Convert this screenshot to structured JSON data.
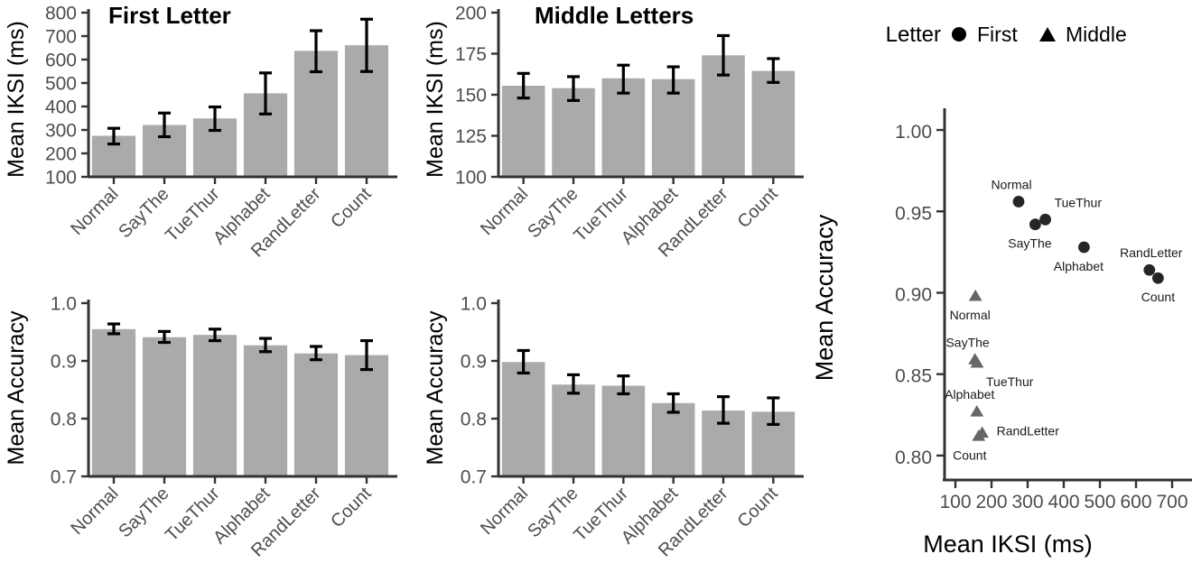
{
  "figure": {
    "conditions": [
      "Normal",
      "SayThe",
      "TueThur",
      "Alphabet",
      "RandLetter",
      "Count"
    ],
    "panels": {
      "first_iksi_title": "First Letter",
      "middle_iksi_title": "Middle Letters",
      "y_title_iksi": "Mean IKSI (ms)",
      "y_title_acc": "Mean Accuracy",
      "x_title_scatter": "Mean IKSI (ms)",
      "y_title_scatter": "Mean Accuracy"
    },
    "legend": {
      "title": "Letter",
      "items": [
        {
          "label": "First",
          "marker": "circle-marker",
          "color": "#262626"
        },
        {
          "label": "Middle",
          "marker": "triangle-marker",
          "color": "#666666"
        }
      ]
    },
    "colors": {
      "bar_fill": "#aaaaaa",
      "error_bar": "#000000",
      "tick_label": "#4d4d4d",
      "axis": "#333333",
      "first_point": "#262626",
      "middle_point": "#666666"
    }
  },
  "chart_data": [
    {
      "type": "bar",
      "id": "first-letter-iksi",
      "title": "First Letter",
      "xlabel": "",
      "ylabel": "Mean IKSI (ms)",
      "categories": [
        "Normal",
        "SayThe",
        "TueThur",
        "Alphabet",
        "RandLetter",
        "Count"
      ],
      "values": [
        275,
        321,
        349,
        456,
        637,
        661
      ],
      "err_low": [
        240,
        271,
        298,
        368,
        548,
        549
      ],
      "err_high": [
        307,
        372,
        398,
        543,
        723,
        772
      ],
      "ylim": [
        100,
        800
      ],
      "yticks": [
        100,
        200,
        300,
        400,
        500,
        600,
        700,
        800
      ],
      "grid": false,
      "legend": "none"
    },
    {
      "type": "bar",
      "id": "middle-letters-iksi",
      "title": "Middle Letters",
      "xlabel": "",
      "ylabel": "Mean IKSI (ms)",
      "categories": [
        "Normal",
        "SayThe",
        "TueThur",
        "Alphabet",
        "RandLetter",
        "Count"
      ],
      "values": [
        155.5,
        154,
        160,
        159.5,
        174,
        164.5
      ],
      "err_low": [
        148,
        146.5,
        151,
        151,
        162,
        157.5
      ],
      "err_high": [
        163,
        161,
        168,
        167,
        186,
        172
      ],
      "ylim": [
        100,
        200
      ],
      "yticks": [
        100,
        125,
        150,
        175,
        200
      ],
      "grid": false,
      "legend": "none"
    },
    {
      "type": "bar",
      "id": "first-letter-accuracy",
      "title": "",
      "xlabel": "",
      "ylabel": "Mean Accuracy",
      "categories": [
        "Normal",
        "SayThe",
        "TueThur",
        "Alphabet",
        "RandLetter",
        "Count"
      ],
      "values": [
        0.955,
        0.941,
        0.945,
        0.927,
        0.913,
        0.91
      ],
      "err_low": [
        0.947,
        0.932,
        0.935,
        0.916,
        0.902,
        0.885
      ],
      "err_high": [
        0.964,
        0.951,
        0.955,
        0.939,
        0.925,
        0.935
      ],
      "ylim": [
        0.7,
        1.0
      ],
      "yticks": [
        0.7,
        0.8,
        0.9,
        1.0
      ],
      "grid": false,
      "legend": "none"
    },
    {
      "type": "bar",
      "id": "middle-letters-accuracy",
      "title": "",
      "xlabel": "",
      "ylabel": "Mean Accuracy",
      "categories": [
        "Normal",
        "SayThe",
        "TueThur",
        "Alphabet",
        "RandLetter",
        "Count"
      ],
      "values": [
        0.898,
        0.859,
        0.857,
        0.827,
        0.814,
        0.812
      ],
      "err_low": [
        0.879,
        0.844,
        0.843,
        0.811,
        0.792,
        0.79
      ],
      "err_high": [
        0.918,
        0.876,
        0.874,
        0.843,
        0.838,
        0.836
      ],
      "ylim": [
        0.7,
        1.0
      ],
      "yticks": [
        0.7,
        0.8,
        0.9,
        1.0
      ],
      "grid": false,
      "legend": "none"
    },
    {
      "type": "scatter",
      "id": "accuracy-vs-iksi-scatter",
      "title": "",
      "xlabel": "Mean IKSI (ms)",
      "ylabel": "Mean Accuracy",
      "xlim": [
        70,
        730
      ],
      "ylim": [
        0.785,
        1.01
      ],
      "xticks": [
        100,
        200,
        300,
        400,
        500,
        600,
        700
      ],
      "yticks": [
        0.8,
        0.85,
        0.9,
        0.95,
        1.0
      ],
      "ytick_labels": [
        "0.80",
        "0.85",
        "0.90",
        "0.95",
        "1.00"
      ],
      "grid": false,
      "legend": "top",
      "series": [
        {
          "name": "First",
          "marker": "circle",
          "color": "#262626",
          "points": [
            {
              "label": "Normal",
              "x": 275,
              "y": 0.956,
              "label_dx": -8,
              "label_dy": -14
            },
            {
              "label": "SayThe",
              "x": 321,
              "y": 0.942,
              "label_dx": -6,
              "label_dy": 26
            },
            {
              "label": "TueThur",
              "x": 349,
              "y": 0.945,
              "label_dx": 10,
              "label_dy": -14
            },
            {
              "label": "Alphabet",
              "x": 456,
              "y": 0.928,
              "label_dx": -6,
              "label_dy": 26
            },
            {
              "label": "RandLetter",
              "x": 637,
              "y": 0.914,
              "label_dx": 2,
              "label_dy": -14
            },
            {
              "label": "Count",
              "x": 661,
              "y": 0.909,
              "label_dx": 0,
              "label_dy": 26
            }
          ]
        },
        {
          "name": "Middle",
          "marker": "triangle",
          "color": "#666666",
          "points": [
            {
              "label": "Normal",
              "x": 155.5,
              "y": 0.898,
              "label_dx": -6,
              "label_dy": 26
            },
            {
              "label": "SayThe",
              "x": 154,
              "y": 0.859,
              "label_dx": -8,
              "label_dy": -14
            },
            {
              "label": "TueThur",
              "x": 160,
              "y": 0.857,
              "label_dx": 10,
              "label_dy": 26
            },
            {
              "label": "Alphabet",
              "x": 159.5,
              "y": 0.827,
              "label_dx": -8,
              "label_dy": -14
            },
            {
              "label": "RandLetter",
              "x": 174,
              "y": 0.814,
              "label_dx": 16,
              "label_dy": 3
            },
            {
              "label": "Count",
              "x": 164.5,
              "y": 0.812,
              "label_dx": -10,
              "label_dy": 26
            }
          ]
        }
      ]
    }
  ]
}
